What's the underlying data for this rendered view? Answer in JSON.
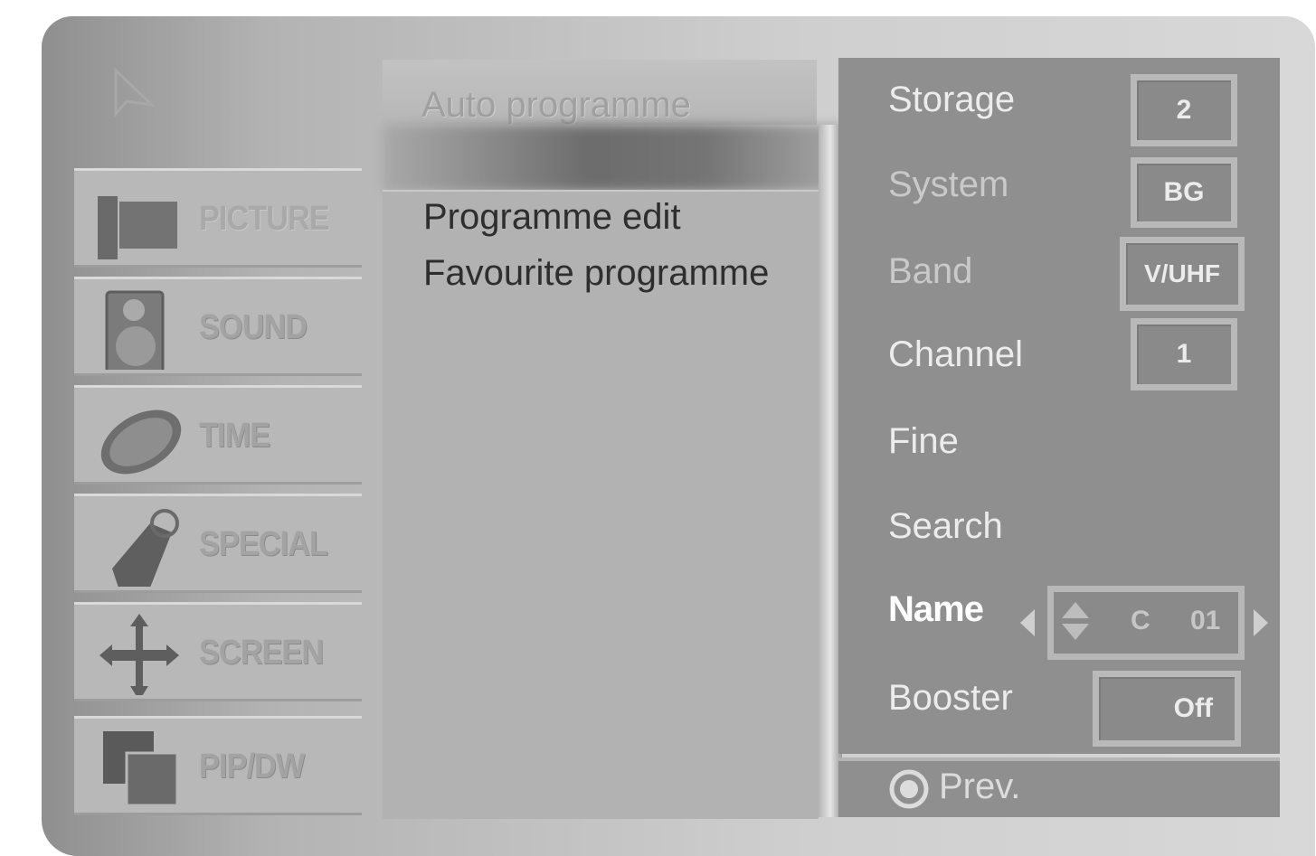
{
  "menu": {
    "categories": [
      {
        "label": "PICTURE",
        "icon": "picture-icon"
      },
      {
        "label": "SOUND",
        "icon": "speaker-icon"
      },
      {
        "label": "TIME",
        "icon": "clock-icon"
      },
      {
        "label": "SPECIAL",
        "icon": "tag-icon"
      },
      {
        "label": "SCREEN",
        "icon": "move-arrows-icon"
      },
      {
        "label": "PIP/DW",
        "icon": "pip-icon"
      }
    ]
  },
  "submenu": {
    "auto_programme": "Auto programme",
    "items": [
      "Programme edit",
      "Favourite programme"
    ]
  },
  "settings": {
    "storage": {
      "label": "Storage",
      "value": "2"
    },
    "system": {
      "label": "System",
      "value": "BG"
    },
    "band": {
      "label": "Band",
      "value": "V/UHF"
    },
    "channel": {
      "label": "Channel",
      "value": "1"
    },
    "fine": {
      "label": "Fine"
    },
    "search": {
      "label": "Search"
    },
    "name": {
      "label": "Name",
      "value_prefix": "C",
      "value": "01"
    },
    "booster": {
      "label": "Booster",
      "value": "Off"
    }
  },
  "footer": {
    "prev_label": "Prev."
  },
  "colors": {
    "panel": "#8f8f8f",
    "frame": "#b9b9b9",
    "highlight_text": "#ffffff"
  }
}
